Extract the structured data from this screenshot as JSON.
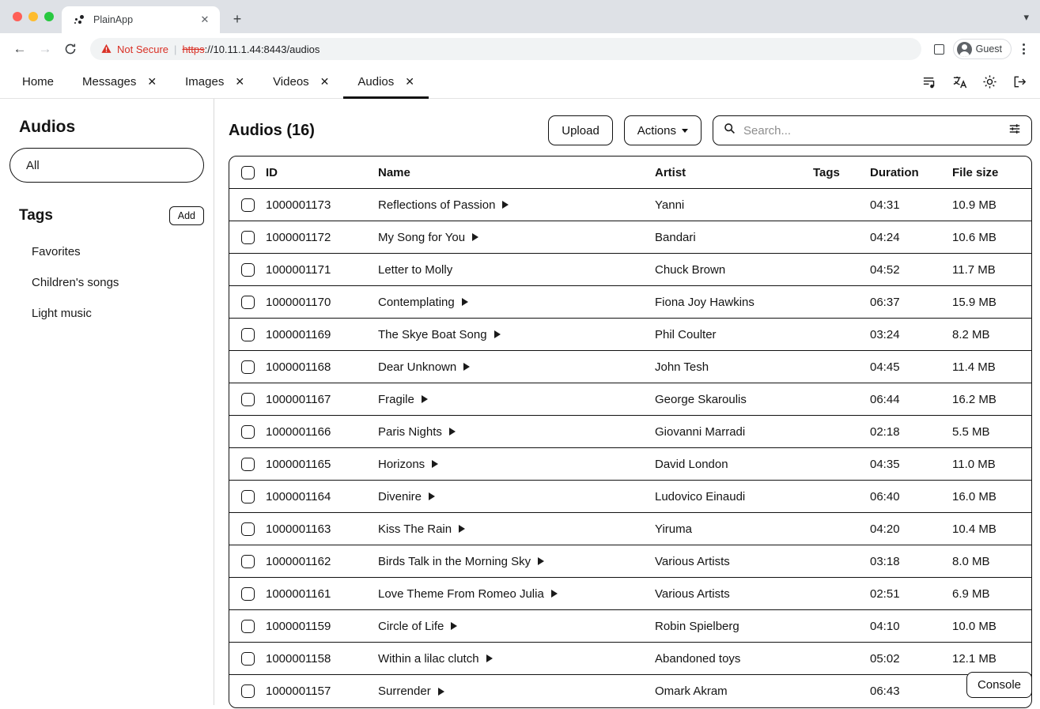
{
  "browser": {
    "tab": {
      "title": "PlainApp",
      "favicon_icon": "dots-cluster-icon",
      "close_icon": "close-icon"
    },
    "newtab_label": "+",
    "chrome_menu_caret": "⌄",
    "nav": {
      "back_icon": "arrow-left-icon",
      "forward_icon": "arrow-right-icon",
      "reload_icon": "reload-icon"
    },
    "omnibox": {
      "warning_icon": "warning-triangle-icon",
      "security_label": "Not Secure",
      "separator": "|",
      "url_protocol": "https",
      "url_rest": "://10.11.1.44:8443/audios"
    },
    "side_panel_icon": "side-panel-icon",
    "profile": {
      "label": "Guest",
      "avatar_icon": "person-avatar-icon"
    },
    "menu_icon": "kebab-menu-icon",
    "colors": {
      "insecure_red": "#d93025",
      "chrome_bg": "#dee1e6",
      "omnibox_bg": "#f1f3f4"
    }
  },
  "appnav": {
    "items": [
      {
        "label": "Home",
        "closable": false,
        "active": false
      },
      {
        "label": "Messages",
        "closable": true,
        "active": false
      },
      {
        "label": "Images",
        "closable": true,
        "active": false
      },
      {
        "label": "Videos",
        "closable": true,
        "active": false
      },
      {
        "label": "Audios",
        "closable": true,
        "active": true
      }
    ],
    "close_glyph": "✕",
    "right_icons": [
      {
        "name": "playlist-queue-music-icon"
      },
      {
        "name": "translate-icon"
      },
      {
        "name": "brightness-sun-icon"
      },
      {
        "name": "logout-icon"
      }
    ]
  },
  "sidebar": {
    "title": "Audios",
    "filter": {
      "value": "All"
    },
    "tags_heading": "Tags",
    "add_label": "Add",
    "tags": [
      {
        "label": "Favorites"
      },
      {
        "label": "Children's songs"
      },
      {
        "label": "Light music"
      }
    ]
  },
  "main": {
    "title": "Audios (16)",
    "upload_label": "Upload",
    "actions_label": "Actions",
    "search": {
      "placeholder": "Search...",
      "value": "",
      "icon": "search-icon",
      "filter_icon": "tune-filter-icon"
    },
    "console_label": "Console",
    "columns": [
      "ID",
      "Name",
      "Artist",
      "Tags",
      "Duration",
      "File size"
    ],
    "rows": [
      {
        "id": "1000001173",
        "name": "Reflections of Passion",
        "playable": true,
        "artist": "Yanni",
        "tags": "",
        "duration": "04:31",
        "size": "10.9 MB"
      },
      {
        "id": "1000001172",
        "name": "My Song for You",
        "playable": true,
        "artist": "Bandari",
        "tags": "",
        "duration": "04:24",
        "size": "10.6 MB"
      },
      {
        "id": "1000001171",
        "name": "Letter to Molly",
        "playable": false,
        "artist": "Chuck Brown",
        "tags": "",
        "duration": "04:52",
        "size": "11.7 MB"
      },
      {
        "id": "1000001170",
        "name": "Contemplating",
        "playable": true,
        "artist": "Fiona Joy Hawkins",
        "tags": "",
        "duration": "06:37",
        "size": "15.9 MB"
      },
      {
        "id": "1000001169",
        "name": "The Skye Boat Song",
        "playable": true,
        "artist": "Phil Coulter",
        "tags": "",
        "duration": "03:24",
        "size": "8.2 MB"
      },
      {
        "id": "1000001168",
        "name": "Dear Unknown",
        "playable": true,
        "artist": "John Tesh",
        "tags": "",
        "duration": "04:45",
        "size": "11.4 MB"
      },
      {
        "id": "1000001167",
        "name": "Fragile",
        "playable": true,
        "artist": "George Skaroulis",
        "tags": "",
        "duration": "06:44",
        "size": "16.2 MB"
      },
      {
        "id": "1000001166",
        "name": "Paris Nights",
        "playable": true,
        "artist": "Giovanni Marradi",
        "tags": "",
        "duration": "02:18",
        "size": "5.5 MB"
      },
      {
        "id": "1000001165",
        "name": "Horizons",
        "playable": true,
        "artist": "David London",
        "tags": "",
        "duration": "04:35",
        "size": "11.0 MB"
      },
      {
        "id": "1000001164",
        "name": "Divenire",
        "playable": true,
        "artist": "Ludovico Einaudi",
        "tags": "",
        "duration": "06:40",
        "size": "16.0 MB"
      },
      {
        "id": "1000001163",
        "name": "Kiss The Rain",
        "playable": true,
        "artist": "Yiruma",
        "tags": "",
        "duration": "04:20",
        "size": "10.4 MB"
      },
      {
        "id": "1000001162",
        "name": "Birds Talk in the Morning Sky",
        "playable": true,
        "artist": "Various Artists",
        "tags": "",
        "duration": "03:18",
        "size": "8.0 MB"
      },
      {
        "id": "1000001161",
        "name": "Love Theme From Romeo Julia",
        "playable": true,
        "artist": "Various Artists",
        "tags": "",
        "duration": "02:51",
        "size": "6.9 MB"
      },
      {
        "id": "1000001159",
        "name": "Circle of Life",
        "playable": true,
        "artist": "Robin Spielberg",
        "tags": "",
        "duration": "04:10",
        "size": "10.0 MB"
      },
      {
        "id": "1000001158",
        "name": "Within a lilac clutch",
        "playable": true,
        "artist": "Abandoned toys",
        "tags": "",
        "duration": "05:02",
        "size": "12.1 MB"
      },
      {
        "id": "1000001157",
        "name": "Surrender",
        "playable": true,
        "artist": "Omark Akram",
        "tags": "",
        "duration": "06:43",
        "size": ""
      }
    ]
  }
}
